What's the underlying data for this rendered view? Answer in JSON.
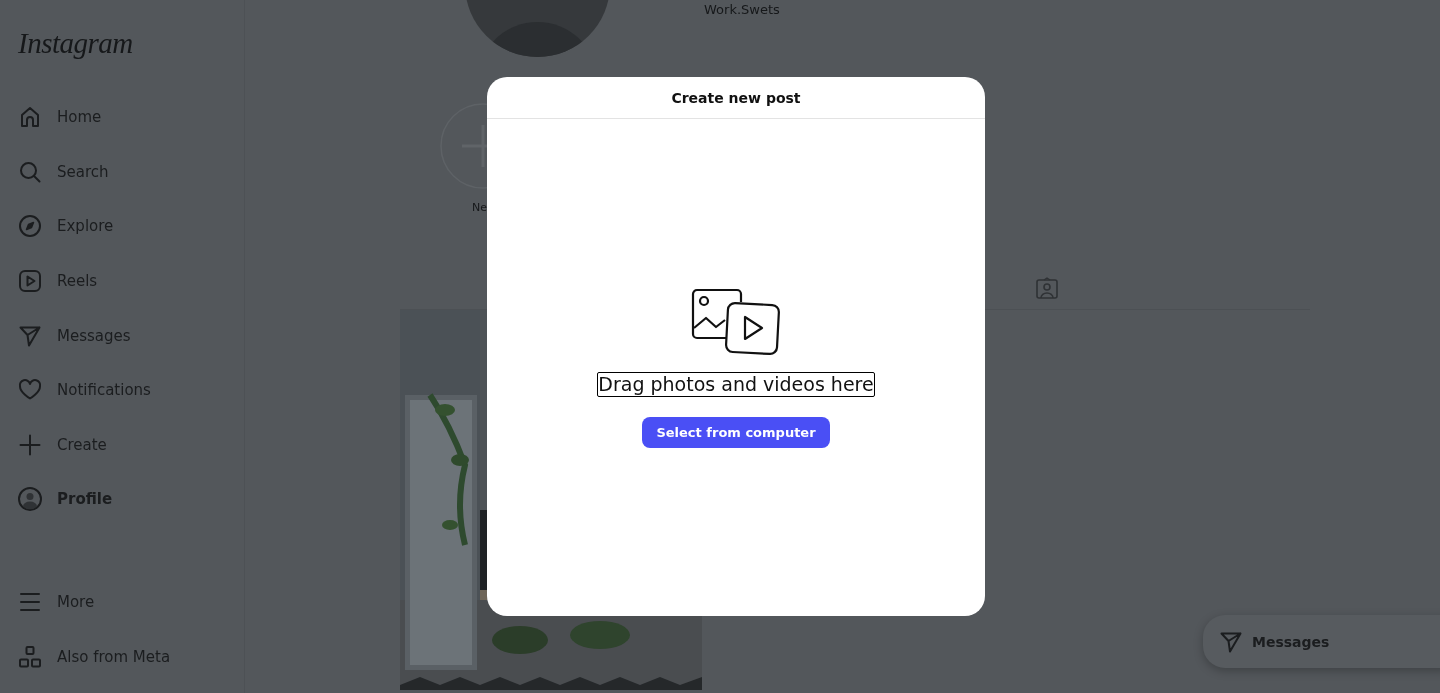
{
  "logo": "Instagram",
  "nav": [
    {
      "label": "Home",
      "kind": "home",
      "selected": false
    },
    {
      "label": "Search",
      "kind": "search",
      "selected": false
    },
    {
      "label": "Explore",
      "kind": "compass",
      "selected": false
    },
    {
      "label": "Reels",
      "kind": "reels",
      "selected": false
    },
    {
      "label": "Messages",
      "kind": "send",
      "selected": false
    },
    {
      "label": "Notifications",
      "kind": "heart",
      "selected": false
    },
    {
      "label": "Create",
      "kind": "plus",
      "selected": false
    },
    {
      "label": "Profile",
      "kind": "avatar",
      "selected": true
    }
  ],
  "nav_bottom": [
    {
      "label": "More",
      "kind": "menu"
    },
    {
      "label": "Also from Meta",
      "kind": "blocks"
    }
  ],
  "profile": {
    "username": "Work.Swets"
  },
  "highlights": [
    {
      "label": "Ne"
    }
  ],
  "modal": {
    "title": "Create new post",
    "prompt": "Drag photos and videos here",
    "button": "Select from computer"
  },
  "messages_pill": {
    "label": "Messages"
  }
}
